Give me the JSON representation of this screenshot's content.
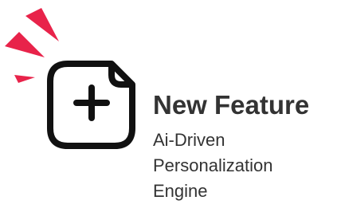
{
  "feature": {
    "icon": "new-document-plus-icon",
    "burst_icon": "attention-burst-icon",
    "accent_color": "#e8234a",
    "stroke_color": "#111111",
    "title": "New Feature",
    "description_lines": [
      "Ai-Driven",
      "Personalization",
      "Engine"
    ]
  }
}
